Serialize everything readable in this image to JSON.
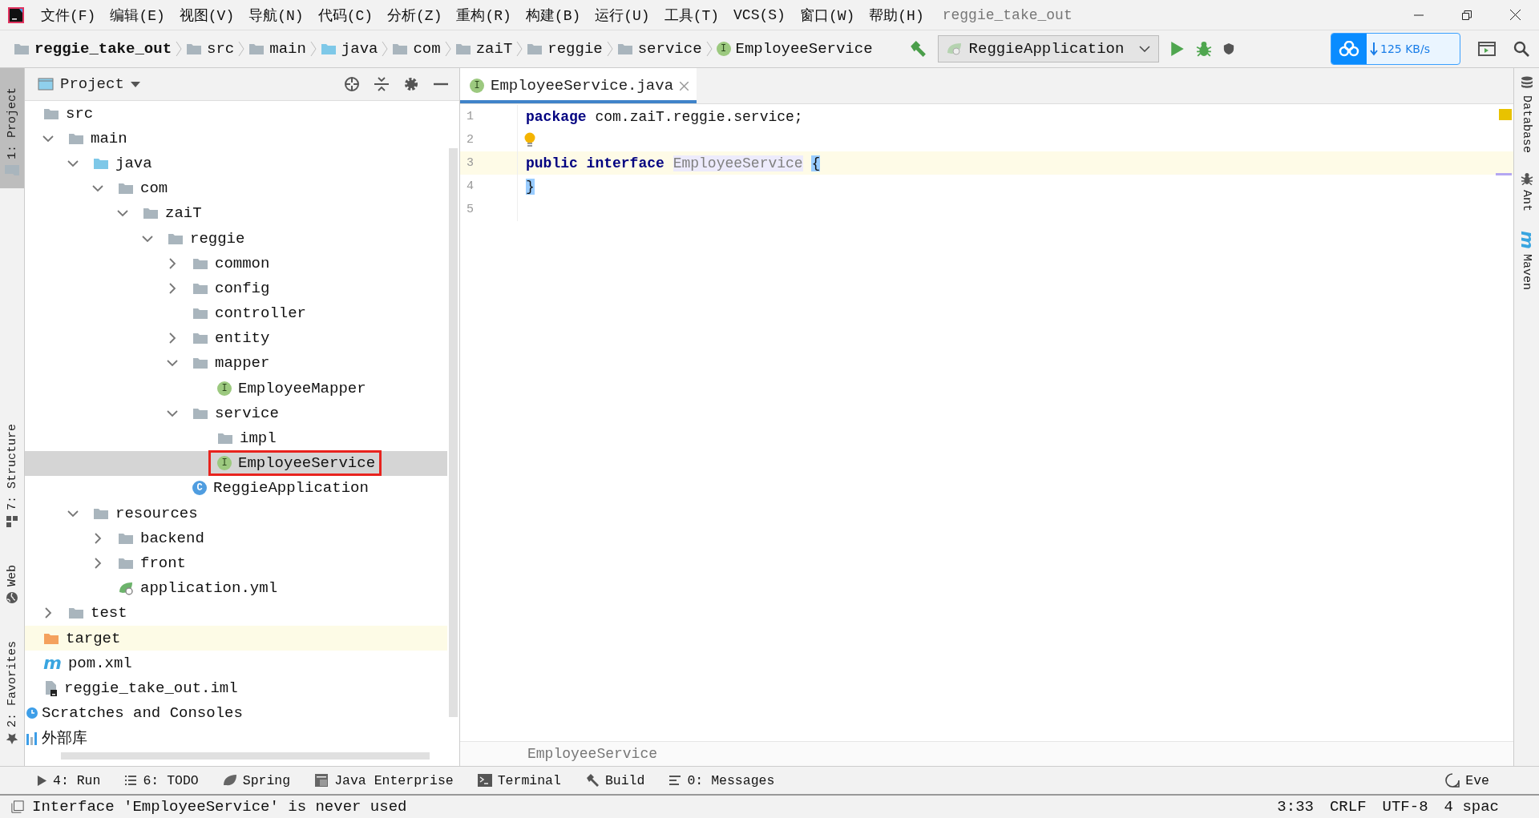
{
  "menu_bar": {
    "items": [
      {
        "label": "文件(F)"
      },
      {
        "label": "编辑(E)"
      },
      {
        "label": "视图(V)"
      },
      {
        "label": "导航(N)"
      },
      {
        "label": "代码(C)"
      },
      {
        "label": "分析(Z)"
      },
      {
        "label": "重构(R)"
      },
      {
        "label": "构建(B)"
      },
      {
        "label": "运行(U)"
      },
      {
        "label": "工具(T)"
      },
      {
        "label": "VCS(S)"
      },
      {
        "label": "窗口(W)"
      },
      {
        "label": "帮助(H)"
      }
    ],
    "title": "reggie_take_out"
  },
  "nav_bar": {
    "breadcrumbs": [
      {
        "label": "reggie_take_out",
        "kind": "module"
      },
      {
        "label": "src",
        "kind": "folder"
      },
      {
        "label": "main",
        "kind": "folder"
      },
      {
        "label": "java",
        "kind": "source-folder"
      },
      {
        "label": "com",
        "kind": "package"
      },
      {
        "label": "zaiT",
        "kind": "package"
      },
      {
        "label": "reggie",
        "kind": "package"
      },
      {
        "label": "service",
        "kind": "package"
      },
      {
        "label": "EmployeeService",
        "kind": "interface",
        "badge": "I"
      }
    ],
    "run_config": "ReggieApplication",
    "download_widget": {
      "speed": "125 KB/s"
    }
  },
  "left_strip": [
    {
      "label": "1: Project",
      "kind": "folder",
      "selected": true
    },
    {
      "label": "7: Structure",
      "kind": "structure",
      "selected": false
    },
    {
      "label": "Web",
      "kind": "globe",
      "selected": false
    },
    {
      "label": "2: Favorites",
      "kind": "star",
      "selected": false
    }
  ],
  "project": {
    "title": "Project",
    "tree": [
      {
        "name": "src",
        "kind": "folder",
        "children": [
          {
            "name": "main",
            "kind": "folder",
            "expanded": true,
            "children": [
              {
                "name": "java",
                "kind": "source-folder",
                "expanded": true,
                "children": [
                  {
                    "name": "com",
                    "kind": "package",
                    "expanded": true,
                    "children": [
                      {
                        "name": "zaiT",
                        "kind": "package",
                        "expanded": true,
                        "children": [
                          {
                            "name": "reggie",
                            "kind": "package",
                            "expanded": true,
                            "children": [
                              {
                                "name": "common",
                                "kind": "package",
                                "expanded": false
                              },
                              {
                                "name": "config",
                                "kind": "package",
                                "expanded": false
                              },
                              {
                                "name": "controller",
                                "kind": "package"
                              },
                              {
                                "name": "entity",
                                "kind": "package",
                                "expanded": false
                              },
                              {
                                "name": "mapper",
                                "kind": "package",
                                "expanded": true,
                                "children": [
                                  {
                                    "name": "EmployeeMapper",
                                    "kind": "interface",
                                    "badge": "I",
                                    "selected": false
                                  }
                                ]
                              },
                              {
                                "name": "service",
                                "kind": "package",
                                "expanded": true,
                                "children": [
                                  {
                                    "name": "impl",
                                    "kind": "package"
                                  },
                                  {
                                    "name": "EmployeeService",
                                    "kind": "interface",
                                    "badge": "I",
                                    "selected": true,
                                    "outlined": true
                                  }
                                ]
                              },
                              {
                                "name": "ReggieApplication",
                                "kind": "spring-class",
                                "badge": "C",
                                "selected": false
                              }
                            ]
                          }
                        ]
                      }
                    ]
                  }
                ]
              },
              {
                "name": "resources",
                "kind": "resources",
                "expanded": true,
                "children": [
                  {
                    "name": "backend",
                    "kind": "folder",
                    "expanded": false
                  },
                  {
                    "name": "front",
                    "kind": "folder",
                    "expanded": false
                  },
                  {
                    "name": "application.yml",
                    "kind": "yml"
                  }
                ]
              }
            ]
          },
          {
            "name": "test",
            "kind": "folder",
            "expanded": false
          }
        ]
      },
      {
        "name": "target",
        "kind": "excluded"
      },
      {
        "name": "pom.xml",
        "kind": "maven",
        "badge": "m"
      },
      {
        "name": "reggie_take_out.iml",
        "kind": "iml"
      }
    ],
    "extra_items": [
      {
        "name": "Scratches and Consoles",
        "kind": "scratches"
      },
      {
        "name": "外部库",
        "kind": "library"
      }
    ]
  },
  "editor": {
    "tabs": [
      {
        "label": "EmployeeService.java",
        "badge": "I",
        "selected": true
      }
    ],
    "lines": [
      {
        "number": "1",
        "current": false,
        "bulb": false,
        "tokens": [
          {
            "text": "package",
            "kind": "keyword"
          },
          {
            "text": "com.zaiT.reggie.service;",
            "kind": "plain"
          }
        ]
      },
      {
        "number": "2",
        "current": false,
        "bulb": true
      },
      {
        "number": "3",
        "current": true,
        "bulb": false,
        "tokens": [
          {
            "text": "public",
            "kind": "keyword"
          },
          {
            "text": "interface",
            "kind": "keyword"
          },
          {
            "text": "EmployeeService",
            "kind": "unused"
          },
          {
            "text": "{",
            "kind": "brace"
          }
        ]
      },
      {
        "number": "4",
        "current": false,
        "bulb": false,
        "tokens": [
          {
            "text": "}",
            "kind": "brace"
          }
        ]
      },
      {
        "number": "5",
        "current": false,
        "bulb": false
      }
    ],
    "breadcrumb": "EmployeeService"
  },
  "right_strip": [
    {
      "label": "Database",
      "kind": "database"
    },
    {
      "label": "Ant",
      "kind": "ant"
    },
    {
      "label": "Maven",
      "kind": "maven",
      "badge": "m"
    }
  ],
  "tool_bar": {
    "items": [
      {
        "label": "4: Run",
        "kind": "run"
      },
      {
        "label": "6: TODO",
        "kind": "list"
      },
      {
        "label": "Spring",
        "kind": "spring"
      },
      {
        "label": "Java Enterprise",
        "kind": "enterprise"
      },
      {
        "label": "Terminal",
        "kind": "terminal"
      },
      {
        "label": "Build",
        "kind": "hammer"
      },
      {
        "label": "0: Messages",
        "kind": "messages"
      }
    ],
    "right_item": {
      "label": "Eve",
      "kind": "bubble"
    }
  },
  "status_bar": {
    "message": "Interface 'EmployeeService' is never used",
    "items": [
      "3:33",
      "CRLF",
      "UTF-8",
      "4 spac"
    ]
  }
}
